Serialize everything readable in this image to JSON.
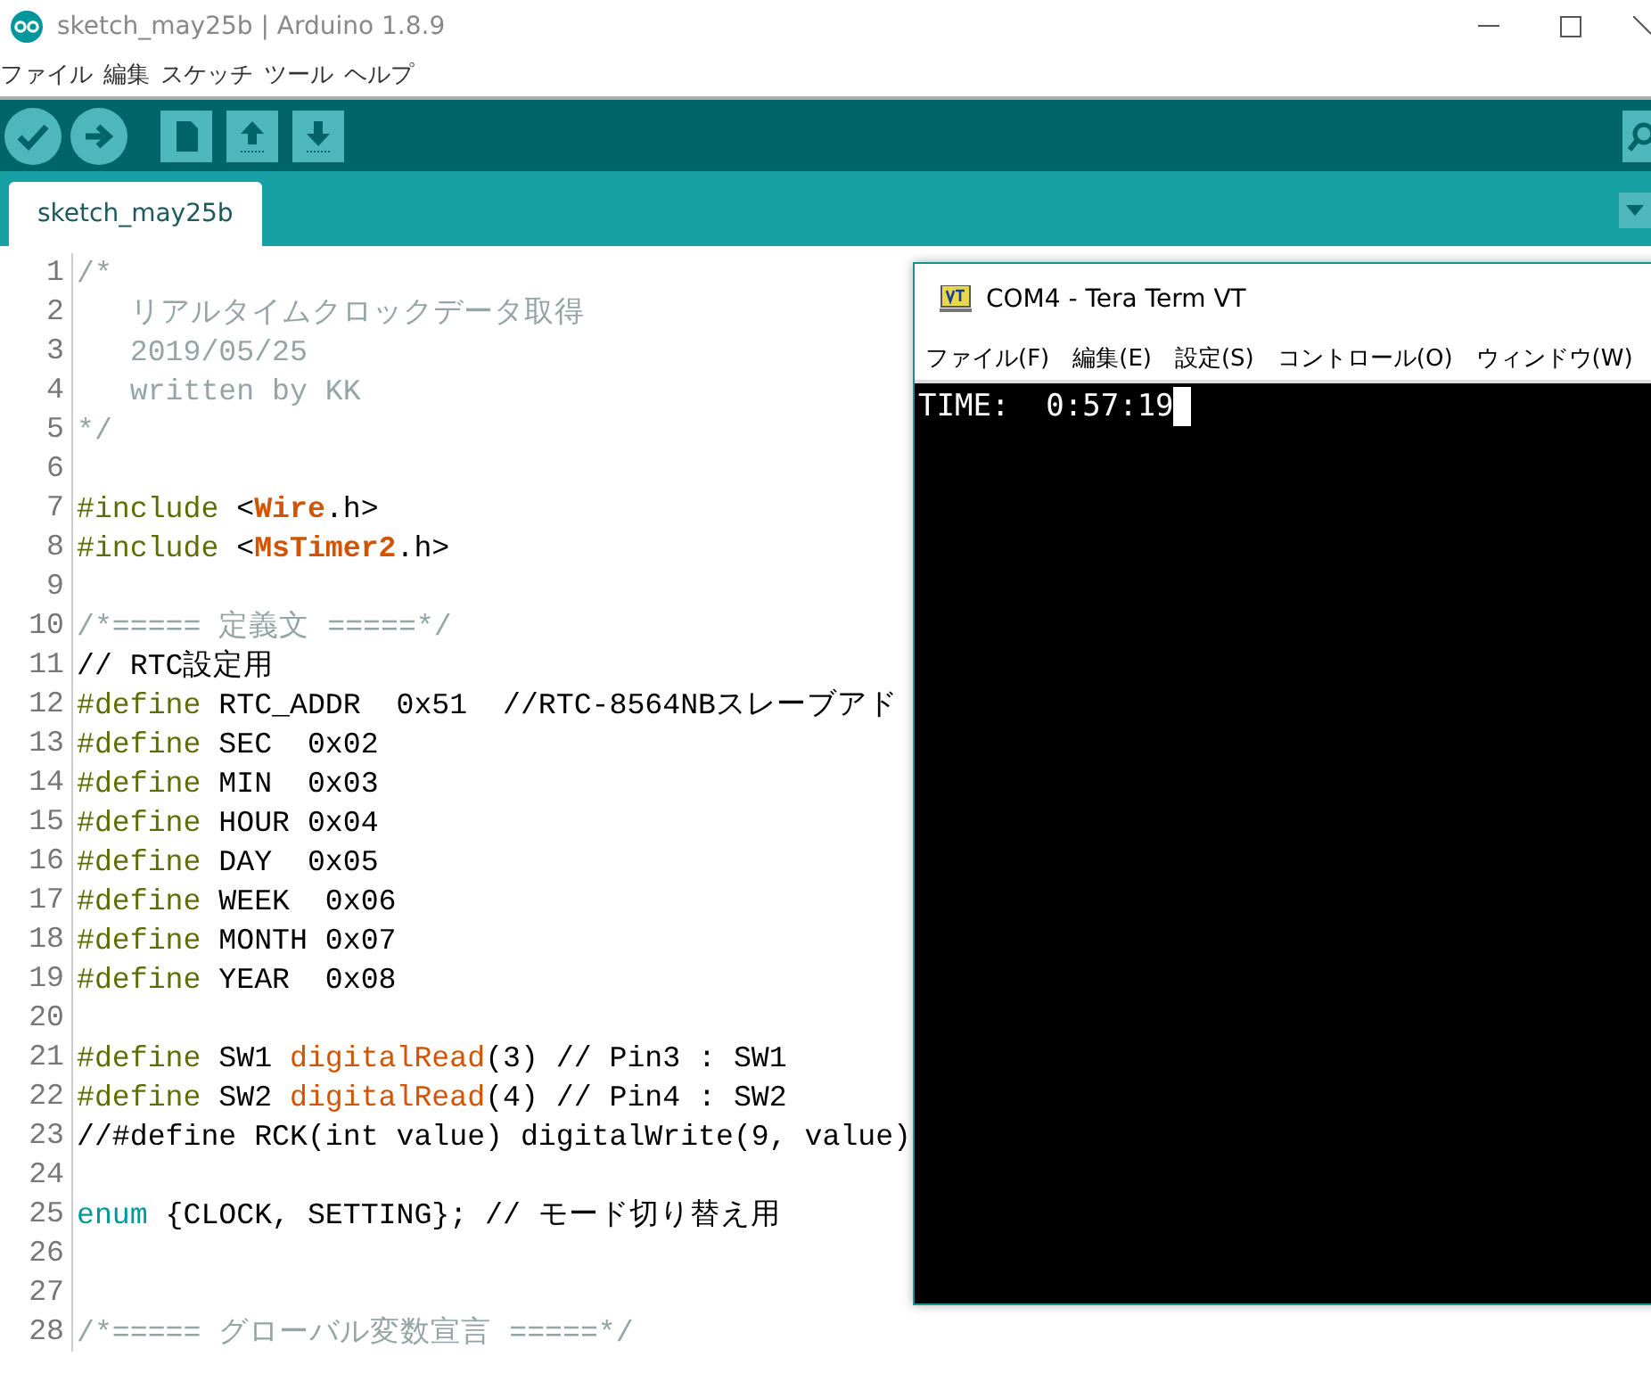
{
  "window": {
    "title": "sketch_may25b | Arduino 1.8.9"
  },
  "menu": [
    "ファイル",
    "編集",
    "スケッチ",
    "ツール",
    "ヘルプ"
  ],
  "tabs": [
    {
      "label": "sketch_may25b",
      "selected": true
    }
  ],
  "editor": {
    "lines": [
      {
        "n": "1",
        "segs": [
          {
            "text": "/*",
            "kind": "comment"
          }
        ]
      },
      {
        "n": "2",
        "segs": [
          {
            "text": "   リアルタイムクロックデータ取得",
            "kind": "comment"
          }
        ]
      },
      {
        "n": "3",
        "segs": [
          {
            "text": "   2019/05/25",
            "kind": "comment"
          }
        ]
      },
      {
        "n": "4",
        "segs": [
          {
            "text": "   written by KK",
            "kind": "comment"
          }
        ]
      },
      {
        "n": "5",
        "segs": [
          {
            "text": "*/",
            "kind": "comment"
          }
        ]
      },
      {
        "n": "6"
      },
      {
        "n": "7",
        "segs": [
          {
            "text": "#include",
            "kind": "preproc"
          },
          {
            "text": " <",
            "kind": "plain"
          },
          {
            "text": "Wire",
            "kind": "lib"
          },
          {
            "text": ".h>",
            "kind": "plain"
          }
        ]
      },
      {
        "n": "8",
        "segs": [
          {
            "text": "#include",
            "kind": "preproc"
          },
          {
            "text": " <",
            "kind": "plain"
          },
          {
            "text": "MsTimer2",
            "kind": "lib"
          },
          {
            "text": ".h>",
            "kind": "plain"
          }
        ]
      },
      {
        "n": "9"
      },
      {
        "n": "10",
        "segs": [
          {
            "text": "/*===== 定義文 =====*/",
            "kind": "comment"
          }
        ]
      },
      {
        "n": "11",
        "segs": [
          {
            "text": "// RTC設定用",
            "kind": "plain"
          }
        ]
      },
      {
        "n": "12",
        "segs": [
          {
            "text": "#define",
            "kind": "preproc"
          },
          {
            "text": " RTC_ADDR  0x51  //RTC-8564NBスレーブアド",
            "kind": "plain"
          }
        ]
      },
      {
        "n": "13",
        "segs": [
          {
            "text": "#define",
            "kind": "preproc"
          },
          {
            "text": " SEC  0x02",
            "kind": "plain"
          }
        ]
      },
      {
        "n": "14",
        "segs": [
          {
            "text": "#define",
            "kind": "preproc"
          },
          {
            "text": " MIN  0x03",
            "kind": "plain"
          }
        ]
      },
      {
        "n": "15",
        "segs": [
          {
            "text": "#define",
            "kind": "preproc"
          },
          {
            "text": " HOUR 0x04",
            "kind": "plain"
          }
        ]
      },
      {
        "n": "16",
        "segs": [
          {
            "text": "#define",
            "kind": "preproc"
          },
          {
            "text": " DAY  0x05",
            "kind": "plain"
          }
        ]
      },
      {
        "n": "17",
        "segs": [
          {
            "text": "#define",
            "kind": "preproc"
          },
          {
            "text": " WEEK  0x06",
            "kind": "plain"
          }
        ]
      },
      {
        "n": "18",
        "segs": [
          {
            "text": "#define",
            "kind": "preproc"
          },
          {
            "text": " MONTH 0x07",
            "kind": "plain"
          }
        ]
      },
      {
        "n": "19",
        "segs": [
          {
            "text": "#define",
            "kind": "preproc"
          },
          {
            "text": " YEAR  0x08",
            "kind": "plain"
          }
        ]
      },
      {
        "n": "20"
      },
      {
        "n": "21",
        "segs": [
          {
            "text": "#define",
            "kind": "preproc"
          },
          {
            "text": " SW1 ",
            "kind": "plain"
          },
          {
            "text": "digitalRead",
            "kind": "func"
          },
          {
            "text": "(3) // Pin3 : SW1",
            "kind": "plain"
          }
        ]
      },
      {
        "n": "22",
        "segs": [
          {
            "text": "#define",
            "kind": "preproc"
          },
          {
            "text": " SW2 ",
            "kind": "plain"
          },
          {
            "text": "digitalRead",
            "kind": "func"
          },
          {
            "text": "(4) // Pin4 : SW2",
            "kind": "plain"
          }
        ]
      },
      {
        "n": "23",
        "segs": [
          {
            "text": "//#define RCK(int value) digitalWrite(9, value)",
            "kind": "plain"
          }
        ]
      },
      {
        "n": "24"
      },
      {
        "n": "25",
        "segs": [
          {
            "text": "enum",
            "kind": "keyword"
          },
          {
            "text": " {CLOCK, SETTING}; // モード切り替え用",
            "kind": "plain"
          }
        ]
      },
      {
        "n": "26"
      },
      {
        "n": "27"
      },
      {
        "n": "28",
        "segs": [
          {
            "text": "/*===== グローバル変数宣言 =====*/",
            "kind": "comment"
          }
        ]
      }
    ]
  },
  "terminal": {
    "title": "COM4 - Tera Term VT",
    "menu": [
      "ファイル(F)",
      "編集(E)",
      "設定(S)",
      "コントロール(O)",
      "ウィンドウ(W)"
    ],
    "output": "TIME:  0:57:19"
  }
}
